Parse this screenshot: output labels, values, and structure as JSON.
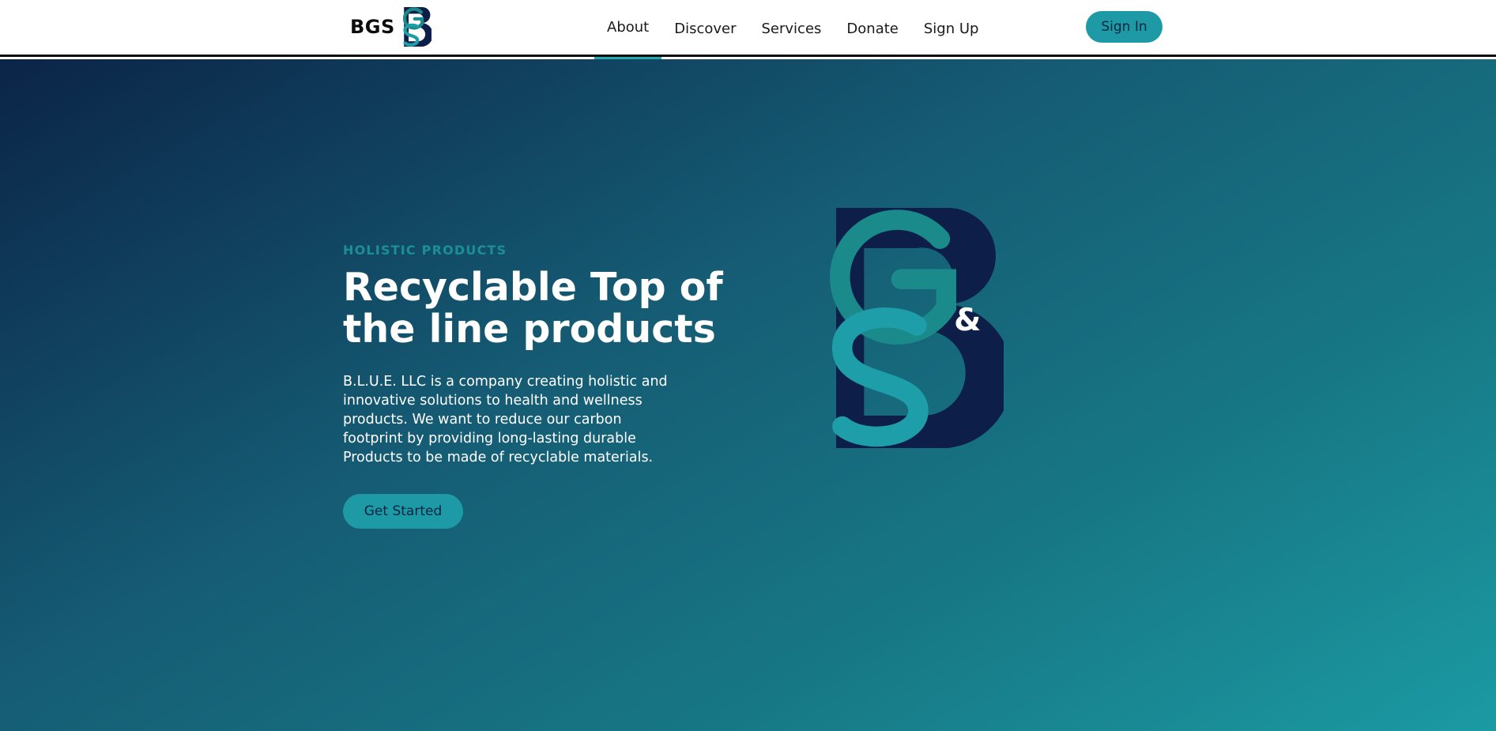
{
  "brand": {
    "name": "BGS",
    "logo_icon": "bgs-monogram-icon"
  },
  "nav": {
    "items": [
      {
        "label": "About",
        "active": true
      },
      {
        "label": "Discover",
        "active": false
      },
      {
        "label": "Services",
        "active": false
      },
      {
        "label": "Donate",
        "active": false
      },
      {
        "label": "Sign Up",
        "active": false
      }
    ],
    "signin_label": "Sign In"
  },
  "hero": {
    "eyebrow": "HOLISTIC PRODUCTS",
    "headline": "Recyclable Top of the line products",
    "description": "B.L.U.E. LLC is a company creating holistic and innovative solutions to health and wellness products. We want to reduce our carbon footprint by providing long-lasting durable Products to be made of recyclable materials.",
    "cta_label": "Get Started",
    "logo_icon": "bgs-monogram-large-icon",
    "logo_ampersand": "&"
  },
  "colors": {
    "accent": "#1d9aa5",
    "nav_underline": "#2aa6ae",
    "eyebrow": "#1b8e96",
    "gradient_start": "#0b2447",
    "gradient_end": "#1b9aa3",
    "logo_navy": "#0d1f48",
    "logo_teal_dark": "#1a8a8a",
    "logo_teal_light": "#1d9ea8"
  }
}
